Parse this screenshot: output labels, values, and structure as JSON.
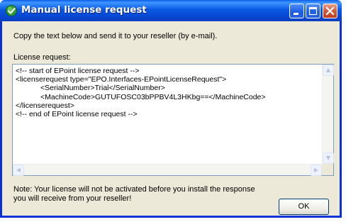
{
  "window": {
    "title": "Manual license request",
    "icon": "checkmark-globe-icon"
  },
  "title_buttons": {
    "minimize": "minimize-icon",
    "maximize": "maximize-icon",
    "close": "close-icon"
  },
  "instruction": "Copy the text below and send it to your reseller (by e-mail).",
  "license_request": {
    "label": "License request:",
    "text": "<!-- start of EPoint license request -->\n<licenserequest type=\"EPO.Interfaces-EPointLicenseRequest\">\n            <SerialNumber>Trial</SerialNumber>\n            <MachineCode>GUTUFOSC03bPPBV4L3HKbg==</MachineCode>\n</licenserequest>\n<!-- end of EPoint license request -->"
  },
  "note": "Note: Your license will not be activated before you install the response you will receive from your reseller!",
  "ok_label": "OK",
  "colors": {
    "title_bar": "#0a5ae4",
    "client_bg": "#ece9d8",
    "close_button": "#d25a3b"
  }
}
